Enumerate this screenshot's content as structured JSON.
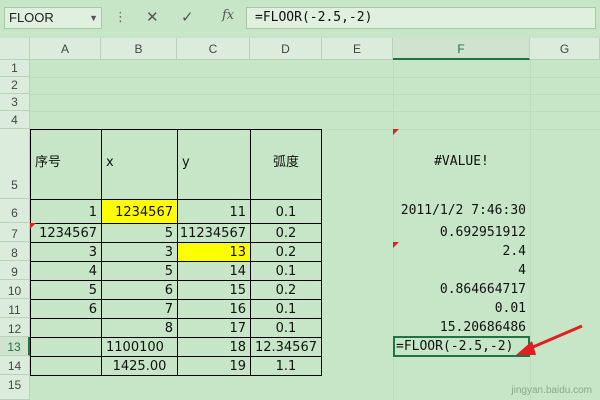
{
  "formula_bar": {
    "name_box": "FLOOR",
    "more_icon": "⋮",
    "cancel_icon": "✕",
    "enter_icon": "✓",
    "fx_label": "fx",
    "formula": "=FLOOR(-2.5,-2)"
  },
  "columns": [
    "A",
    "B",
    "C",
    "D",
    "E",
    "F",
    "G"
  ],
  "rows": [
    "1",
    "2",
    "3",
    "4",
    "5",
    "6",
    "7",
    "8",
    "9",
    "10",
    "11",
    "12",
    "13",
    "14",
    "15"
  ],
  "cells": {
    "A5": "序号",
    "B5": "x",
    "C5": "y",
    "D5": "弧度",
    "F5": "#VALUE!",
    "A6": "1",
    "B6": "1234567",
    "C6": "11",
    "D6": "0.1",
    "F6": "2011/1/2 7:46:30",
    "A7": "1234567",
    "B7": "5",
    "C7": "11234567",
    "D7": "0.2",
    "F7": "0.692951912",
    "A8": "3",
    "B8": "3",
    "C8": "13",
    "D8": "0.2",
    "F8": "2.4",
    "A9": "4",
    "B9": "5",
    "C9": "14",
    "D9": "0.1",
    "F9": "4",
    "A10": "5",
    "B10": "6",
    "C10": "15",
    "D10": "0.2",
    "F10": "0.864664717",
    "A11": "6",
    "B11": "7",
    "C11": "16",
    "D11": "0.1",
    "F11": "0.01",
    "B12": "8",
    "C12": "17",
    "D12": "0.1",
    "F12": "15.20686486",
    "B13": "1100100",
    "C13": "18",
    "D13": "12.34567",
    "F13": "=FLOOR(-2.5,-2)",
    "B14": "1425.00",
    "C14": "19",
    "D14": "1.1"
  },
  "watermark": "jingyan.baidu.com",
  "colors": {
    "background": "#c7e6c7",
    "highlight": "#ffff00",
    "select": "#217346",
    "arrow": "#e02020"
  },
  "active_cell": "F13"
}
